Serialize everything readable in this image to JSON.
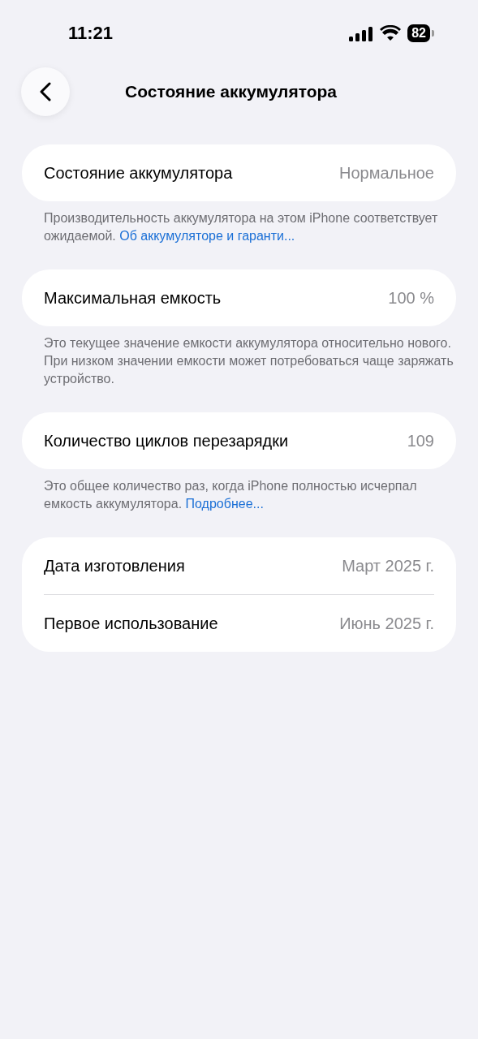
{
  "status_bar": {
    "time": "11:21",
    "battery": "82"
  },
  "nav": {
    "title": "Состояние аккумулятора"
  },
  "sections": [
    {
      "rows": [
        {
          "label": "Состояние аккумулятора",
          "value": "Нормальное"
        }
      ],
      "footer": [
        {
          "kind": "text",
          "text": "Производительность аккумулятора на этом iPhone соответствует ожидаемой."
        },
        {
          "kind": "link",
          "text": "Об аккумуляторе и гаранти..."
        }
      ]
    },
    {
      "rows": [
        {
          "label": "Максимальная емкость",
          "value": "100 %"
        }
      ],
      "footer": [
        {
          "kind": "text",
          "text": "Это текущее значение емкости аккумулятора относительно нового. При низком значении емкости может потребоваться чаще заряжать устройство."
        }
      ]
    },
    {
      "rows": [
        {
          "label": "Количество циклов перезарядки",
          "value": "109"
        }
      ],
      "footer": [
        {
          "kind": "text",
          "text": "Это общее количество раз, когда iPhone полностью исчерпал емкость аккумулятора."
        },
        {
          "kind": "link",
          "text": "Подробнее..."
        }
      ]
    },
    {
      "rows": [
        {
          "label": "Дата изготовления",
          "value": "Март 2025 г."
        },
        {
          "label": "Первое использование",
          "value": "Июнь 2025 г."
        }
      ]
    }
  ]
}
